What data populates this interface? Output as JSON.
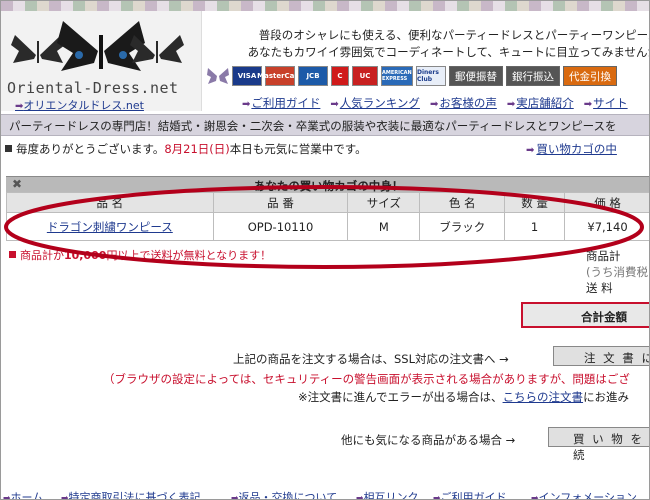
{
  "header": {
    "logo_en": "Oriental-Dress.net",
    "logo_jp": "オリエンタルドレス.net",
    "slogan_line1": "普段のオシャレにも使える、便利なパーティードレスとパーティーワンピース",
    "slogan_line2": "あなたもカワイイ雰囲気でコーディネートして、キュートに目立ってみませんか",
    "cards": [
      "VISA",
      "MasterCard",
      "JCB",
      "C",
      "UC",
      "AMERICAN EXPRESS",
      "Diners Club"
    ],
    "payments": [
      "郵便振替",
      "銀行振込",
      "代金引換"
    ],
    "nav": [
      "ご利用ガイド",
      "人気ランキング",
      "お客様の声",
      "実店舗紹介",
      "サイト"
    ]
  },
  "banner": "パーティードレスの専門店！結婚式・謝恩会・二次会・卒業式の服装や衣装に最適なパーティードレスとワンピースを",
  "greeting": {
    "pre": "毎度ありがとうございます。",
    "date": "8月21日(日)",
    "post": "本日も元気に営業中です。",
    "cart_link": "買い物カゴの中"
  },
  "cart": {
    "title": "あなたの買い物カゴの中身！",
    "headers": [
      "品 名",
      "品 番",
      "サイズ",
      "色 名",
      "数 量",
      "価 格"
    ],
    "rows": [
      {
        "name": "ドラゴン刺繍ワンピース",
        "code": "OPD-10110",
        "size": "M",
        "color": "ブラック",
        "qty": "1",
        "price": "¥7,140"
      }
    ]
  },
  "freeship": {
    "pre": "商品計か",
    "amount": "10,000",
    "post": "円以上で送料が無料となります！"
  },
  "totals": {
    "subtotal": "商品計",
    "tax": "(うち消費税",
    "shipping": "送 料",
    "grand_button": "合計金額"
  },
  "order": {
    "text": "上記の商品を注文する場合は、SSL対応の注文書へ →",
    "button": "注 文 書 に",
    "warning": "（ブラウザの設定によっては、セキュリティーの警告画面が表示される場合がありますが、問題はござ",
    "note_pre": "※注文書に進んでエラーが出る場合は、",
    "note_link": "こちらの注文書",
    "note_post": "にお進み"
  },
  "more": {
    "text": "他にも気になる商品がある場合 →",
    "button": "買 い 物 を 続"
  },
  "footer": [
    "ホーム",
    "特定商取引法に基づく表記",
    "返品・交換について",
    "相互リンク",
    "ご利用ガイド",
    "インフォメーション"
  ],
  "colors": {
    "accent_red": "#c8102e",
    "link_blue": "#1f3a8f",
    "banner_bg": "#d7d4de"
  }
}
